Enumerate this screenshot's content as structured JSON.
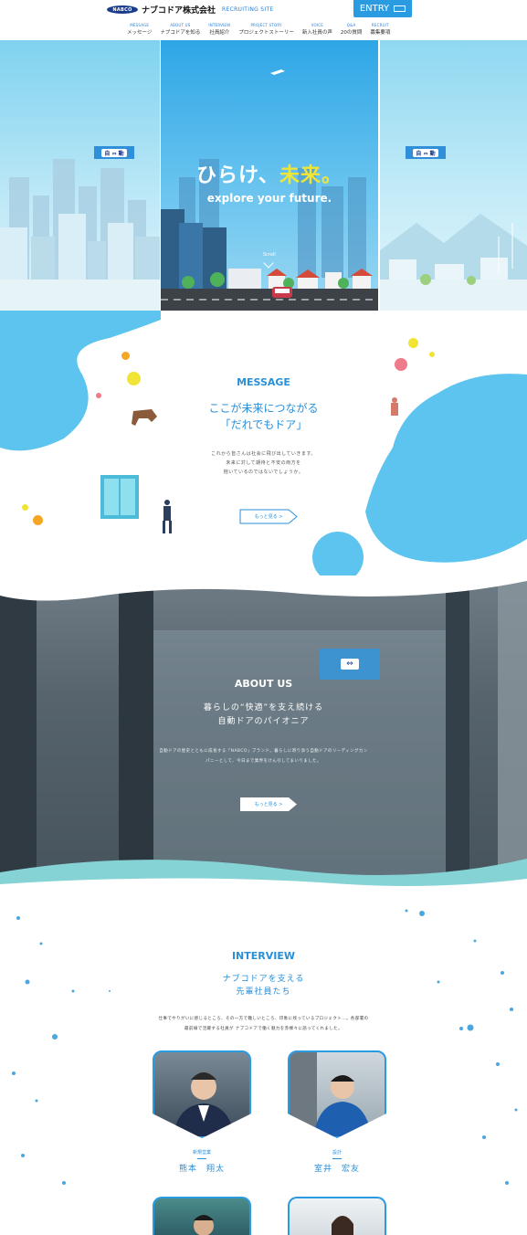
{
  "header": {
    "logo_badge": "NABCO",
    "logo_name": "ナブコドア株式会社",
    "logo_sub": "RECRUITING SITE",
    "entry_label": "ENTRY",
    "nav": [
      {
        "en": "MESSAGE",
        "jp": "メッセージ"
      },
      {
        "en": "ABOUT US",
        "jp": "ナブコドアを知る"
      },
      {
        "en": "INTERVIEW",
        "jp": "社員紹介"
      },
      {
        "en": "PROJECT STORY",
        "jp": "プロジェクトストーリー"
      },
      {
        "en": "VOICE",
        "jp": "新入社員の声"
      },
      {
        "en": "Q&A",
        "jp": "20の質問"
      },
      {
        "en": "RECRUIT",
        "jp": "募集要項"
      }
    ]
  },
  "hero": {
    "door_sign": "自 ⇔ 動",
    "title_main": "ひらけ、",
    "title_accent": "未来。",
    "subtitle": "explore your future.",
    "scroll_label": "Scroll"
  },
  "message": {
    "heading": "MESSAGE",
    "catch_1": "ここが未来につながる",
    "catch_2": "「だれでもドア」",
    "body_1": "これから皆さんは社会に飛び出していきます。",
    "body_2": "未来に対して期待と不安の両方を",
    "body_3": "抱いているのではないでしょうか。",
    "more": "もっと見る >"
  },
  "about": {
    "heading": "ABOUT US",
    "catch_1": "暮らしの“快適”を支え続ける",
    "catch_2": "自動ドアのパイオニア",
    "body_1": "自動ドアの歴史とともに成長する「NABCO」ブランド。暮らしに寄り添う自動ドアのリーディングカン",
    "body_2": "パニーとして、今日まで業界をけん引してまいりました。",
    "more": "もっと見る >"
  },
  "interview": {
    "heading": "INTERVIEW",
    "catch_1": "ナブコドアを支える",
    "catch_2": "先輩社員たち",
    "body_1": "仕事でやりがいに感じるところ、その一方で難しいところ、印象に残っているプロジェクト…。各部署の",
    "body_2": "最前線で活躍する社員が ナブコドアで働く魅力を赤裸々に語ってくれました。",
    "people": [
      {
        "dept": "新規営業",
        "name": "熊本　翔太"
      },
      {
        "dept": "設計",
        "name": "室井　宏友"
      }
    ]
  },
  "colors": {
    "brand_blue": "#2a8fd8",
    "accent_yellow": "#f0e436",
    "blob_blue": "#5cc4ee",
    "navy": "#1a3c8c"
  }
}
